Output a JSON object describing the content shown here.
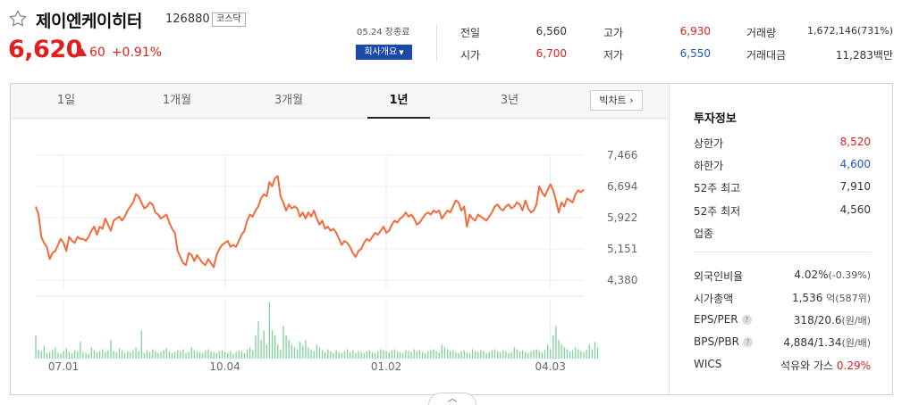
{
  "stock": {
    "name": "제이엔케이히터",
    "code": "126880",
    "market": "코스닥",
    "price": "6,620",
    "change": "60",
    "change_rate": "+0.91%",
    "date_status": "05.24 장종료",
    "company_button": "회사개요"
  },
  "quote": {
    "prev_close_label": "전일",
    "prev_close": "6,560",
    "open_label": "시가",
    "open": "6,700",
    "high_label": "고가",
    "high": "6,930",
    "low_label": "저가",
    "low": "6,550",
    "volume_label": "거래량",
    "volume": "1,672,146(731%)",
    "amount_label": "거래대금",
    "amount": "11,283",
    "amount_unit": "백만"
  },
  "tabs": [
    {
      "label": "1일"
    },
    {
      "label": "1개월"
    },
    {
      "label": "3개월"
    },
    {
      "label": "1년"
    },
    {
      "label": "3년"
    }
  ],
  "active_tab": "1년",
  "big_chart_button": "빅차트",
  "chart_data": {
    "type": "line",
    "yticks": [
      "7,466",
      "6,694",
      "5,922",
      "5,151",
      "4,380"
    ],
    "ytick_values": [
      7466,
      6694,
      5922,
      5151,
      4380
    ],
    "xticks": [
      "07.01",
      "10.04",
      "01.02",
      "04.03"
    ],
    "xtick_index": [
      10,
      68,
      126,
      185
    ],
    "ylim": [
      4380,
      7466
    ],
    "grid": true,
    "colors": {
      "line": "#f26b3c",
      "volume": "#7fd19b"
    },
    "price": [
      6200,
      6000,
      5450,
      5300,
      5200,
      4900,
      5050,
      5100,
      5250,
      5400,
      5300,
      5100,
      5450,
      5350,
      5300,
      5450,
      5400,
      5400,
      5350,
      5450,
      5600,
      5700,
      5500,
      5700,
      5650,
      5900,
      5750,
      5600,
      5850,
      5900,
      5950,
      5850,
      5950,
      6100,
      6200,
      6300,
      6500,
      6450,
      6300,
      6150,
      6200,
      6300,
      6250,
      6050,
      6000,
      5900,
      5950,
      6000,
      5800,
      5650,
      5550,
      5100,
      4950,
      4800,
      4750,
      5050,
      5000,
      4850,
      5000,
      4900,
      4800,
      4750,
      4900,
      4800,
      4700,
      5000,
      5150,
      5250,
      5300,
      5350,
      5200,
      5250,
      5200,
      5350,
      5500,
      5600,
      5850,
      6000,
      5950,
      6100,
      6200,
      6400,
      6500,
      6450,
      6800,
      6700,
      6900,
      6950,
      6450,
      6300,
      6100,
      6250,
      6150,
      6200,
      6150,
      5950,
      6050,
      5900,
      6050,
      5950,
      6100,
      5900,
      5750,
      5850,
      5650,
      5700,
      5600,
      5650,
      5550,
      5400,
      5250,
      5350,
      5300,
      5200,
      5050,
      4950,
      5100,
      5150,
      5300,
      5400,
      5350,
      5450,
      5550,
      5500,
      5600,
      5700,
      5550,
      5600,
      5750,
      5850,
      5800,
      5900,
      5950,
      6050,
      5950,
      6000,
      5900,
      5750,
      5800,
      5900,
      6000,
      6050,
      6000,
      6100,
      6050,
      6100,
      5900,
      6000,
      6100,
      6050,
      6200,
      6350,
      6300,
      6100,
      6200,
      5700,
      6000,
      5900,
      5850,
      6000,
      5950,
      5900,
      5850,
      5950,
      6050,
      6200,
      6250,
      6150,
      6100,
      6200,
      6250,
      6150,
      6200,
      6300,
      6250,
      6100,
      6350,
      6150,
      6050,
      6100,
      6250,
      6700,
      6550,
      6450,
      6600,
      6750,
      6600,
      6350,
      6050,
      6300,
      6200,
      6400,
      6350,
      6300,
      6500,
      6600,
      6550,
      6620
    ],
    "volume": [
      25,
      10,
      8,
      14,
      6,
      7,
      9,
      12,
      6,
      5,
      8,
      11,
      7,
      6,
      9,
      8,
      18,
      7,
      6,
      5,
      12,
      9,
      7,
      8,
      10,
      7,
      9,
      20,
      8,
      7,
      11,
      9,
      6,
      8,
      7,
      9,
      12,
      8,
      30,
      6,
      9,
      7,
      10,
      8,
      6,
      7,
      9,
      11,
      8,
      6,
      7,
      9,
      8,
      10,
      6,
      7,
      12,
      9,
      8,
      7,
      6,
      9,
      10,
      8,
      7,
      6,
      8,
      9,
      7,
      6,
      8,
      5,
      7,
      9,
      8,
      6,
      10,
      12,
      9,
      25,
      40,
      20,
      30,
      15,
      60,
      30,
      25,
      15,
      10,
      35,
      25,
      20,
      15,
      12,
      10,
      18,
      14,
      20,
      12,
      10,
      8,
      15,
      12,
      9,
      7,
      10,
      8,
      6,
      9,
      7,
      6,
      8,
      10,
      7,
      9,
      6,
      8,
      7,
      6,
      8,
      9,
      7,
      6,
      8,
      10,
      9,
      8,
      7,
      9,
      10,
      8,
      7,
      6,
      9,
      8,
      7,
      10,
      8,
      9,
      7,
      6,
      8,
      9,
      10,
      8,
      7,
      15,
      12,
      10,
      8,
      9,
      7,
      6,
      8,
      9,
      7,
      6,
      10,
      8,
      7,
      9,
      8,
      6,
      7,
      9,
      10,
      8,
      7,
      9,
      8,
      6,
      7,
      12,
      10,
      8,
      9,
      7,
      6,
      8,
      9,
      10,
      8,
      7,
      9,
      15,
      10,
      25,
      35,
      20,
      15,
      12,
      10,
      8,
      9,
      12,
      10,
      8,
      7,
      9,
      15,
      10,
      18,
      12
    ]
  },
  "invest_info": {
    "title": "투자정보",
    "upper_limit_label": "상한가",
    "upper_limit": "8,520",
    "lower_limit_label": "하한가",
    "lower_limit": "4,600",
    "high52_label": "52주 최고",
    "high52": "7,910",
    "low52_label": "52주 최저",
    "low52": "4,560",
    "industry_label": "업종",
    "foreign_label": "외국인비율",
    "foreign": "4.02%",
    "foreign_change": "(-0.39%)",
    "mcap_label": "시가총액",
    "mcap": "1,536",
    "mcap_unit": "억(587위)",
    "eps_label": "EPS/PER",
    "eps": "318/20.6",
    "eps_unit": "(원/배)",
    "bps_label": "BPS/PBR",
    "bps": "4,884/1.34",
    "bps_unit": "(원/배)",
    "wics_label": "WICS",
    "wics": "석유와 가스",
    "wics_rate": "0.29%"
  },
  "icons": {
    "favorite": "star-outline-icon",
    "help": "question-icon",
    "collapse": "chevron-up-icon"
  }
}
